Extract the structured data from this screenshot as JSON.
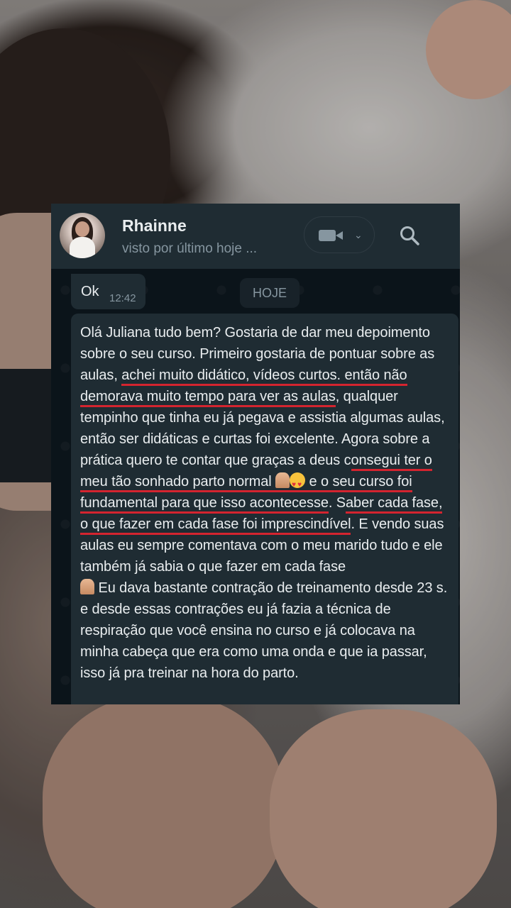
{
  "chat": {
    "contact_name": "Rhainne",
    "contact_status": "visto por último hoje ...",
    "icons": {
      "video": "video-camera-icon",
      "dropdown": "chevron-down-icon",
      "search": "search-icon"
    }
  },
  "messages": {
    "ok": {
      "text": "Ok",
      "time": "12:42"
    },
    "date_separator": "HOJE",
    "testimonial": {
      "p1": "Olá Juliana tudo bem? Gostaria de dar meu depoimento sobre o seu curso. Primeiro gostaria de pontuar sobre as aulas, ",
      "u1": "achei muito didático, vídeos curtos. então não demorava muito tempo para ver as aulas",
      "p2": ", qualquer tempinho que tinha eu já pegava e assistia algumas aulas, então ser didáticas e curtas foi excelente. Agora sobre a prática quero te contar que graças a deus c",
      "u2": "onsegui ter o meu tão sonhado parto normal",
      "u3": "e o seu curso foi fundamental para que isso acontecesse",
      "p3": ". S",
      "u4": "aber cada fase, o que fazer em cada fase foi imprescindível",
      "p4": ". E vendo suas aulas eu sempre comentava com o meu marido tudo e ele também já sabia o que fazer em cada fase",
      "p5": " Eu dava bastante contração de treinamento desde 23 s. e desde essas contrações eu já fazia a técnica de respiração que você ensina no curso e já colocava na minha cabeça que era como uma onda e que ia passar, isso já pra treinar na hora do parto."
    }
  },
  "colors": {
    "header_bg": "#1f2c33",
    "chat_bg": "#0b141a",
    "bubble_bg": "#1f2c33",
    "highlight_underline": "#d4242f"
  }
}
